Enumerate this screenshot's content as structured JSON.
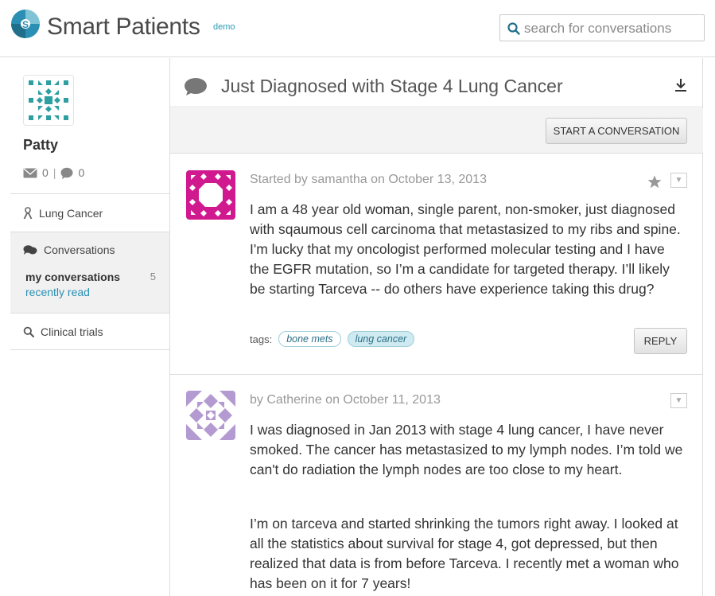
{
  "header": {
    "brand": "Smart Patients",
    "brand_tag": "demo",
    "search_placeholder": "search for conversations"
  },
  "sidebar": {
    "username": "Patty",
    "messages_count": "0",
    "separator": "|",
    "comments_count": "0",
    "community": "Lung Cancer",
    "conversations_heading": "Conversations",
    "my_conversations": "my conversations",
    "my_conversations_count": "5",
    "recently_read": "recently read",
    "clinical_trials": "Clinical trials"
  },
  "conversation": {
    "title": "Just Diagnosed with Stage 4 Lung Cancer",
    "start_button": "START A CONVERSATION"
  },
  "posts": [
    {
      "meta": "Started by samantha on October 13, 2013",
      "paragraphs": [
        "I am a 48 year old woman, single parent, non-smoker, just diagnosed with sqaumous cell carcinoma that metastasized to my ribs and spine. I'm lucky that my oncologist performed molecular testing and I have the EGFR mutation, so I’m a candidate for targeted therapy. I’ll likely be starting Tarceva -- do others have experience taking this drug?"
      ],
      "tags_label": "tags:",
      "tags": [
        "bone mets",
        "lung cancer"
      ],
      "reply_button": "REPLY",
      "avatar_color": "#d1198f"
    },
    {
      "meta": "by Catherine on October 11, 2013",
      "paragraphs": [
        "I was diagnosed in Jan 2013 with stage 4 lung cancer, I have never smoked. The cancer has metastasized to my lymph nodes. I’m told we can't do radiation the lymph nodes are too close to my heart.",
        "I’m on tarceva and started shrinking the tumors right away. I looked at all the statistics about survival for stage 4, got depressed, but then realized that data is from before Tarceva. I recently met a woman who has been on it for 7 years!"
      ],
      "avatar_color": "#b39ad1"
    }
  ],
  "colors": {
    "accent": "#2a8fb3",
    "user_avatar": "#2e9fa0"
  },
  "icons": [
    "logo-icon",
    "search-icon",
    "envelope-icon",
    "comment-icon",
    "ribbon-icon",
    "chat-bubbles-icon",
    "download-icon",
    "star-icon",
    "chevron-down-icon"
  ]
}
